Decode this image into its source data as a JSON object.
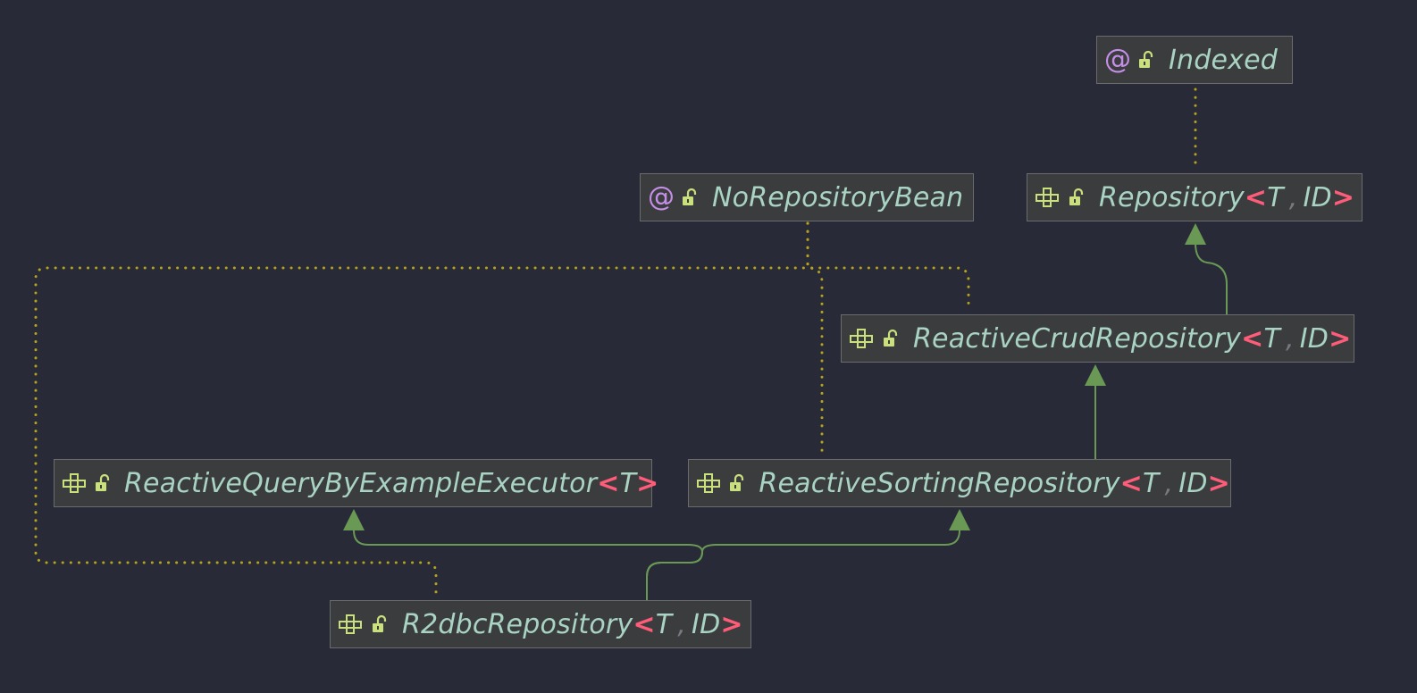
{
  "diagram": {
    "colors": {
      "background": "#282a37",
      "node_fill": "#3b3c3e",
      "node_border": "#6a6b6d",
      "name_text": "#a9d3c3",
      "generic_bracket": "#ff5c79",
      "annotation_icon": "#c58ee8",
      "interface_icon": "#c9e07c",
      "inheritance_edge": "#6a9955",
      "annotation_edge": "#b5a31a"
    },
    "nodes": [
      {
        "id": "indexed",
        "kind": "annotation",
        "icon": "at-icon",
        "name": "Indexed",
        "type_params": []
      },
      {
        "id": "no-repository-bean",
        "kind": "annotation",
        "icon": "at-icon",
        "name": "NoRepositoryBean",
        "type_params": []
      },
      {
        "id": "repository",
        "kind": "interface",
        "icon": "interface-icon",
        "name": "Repository",
        "type_params": [
          "T",
          "ID"
        ]
      },
      {
        "id": "reactive-crud-repository",
        "kind": "interface",
        "icon": "interface-icon",
        "name": "ReactiveCrudRepository",
        "type_params": [
          "T",
          "ID"
        ]
      },
      {
        "id": "reactive-query-by-example-executor",
        "kind": "interface",
        "icon": "interface-icon",
        "name": "ReactiveQueryByExampleExecutor",
        "type_params": [
          "T"
        ]
      },
      {
        "id": "reactive-sorting-repository",
        "kind": "interface",
        "icon": "interface-icon",
        "name": "ReactiveSortingRepository",
        "type_params": [
          "T",
          "ID"
        ]
      },
      {
        "id": "r2dbc-repository",
        "kind": "interface",
        "icon": "interface-icon",
        "name": "R2dbcRepository",
        "type_params": [
          "T",
          "ID"
        ]
      }
    ],
    "edges": [
      {
        "from": "repository",
        "to": "indexed",
        "type": "annotated-by"
      },
      {
        "from": "reactive-crud-repository",
        "to": "repository",
        "type": "extends"
      },
      {
        "from": "reactive-crud-repository",
        "to": "no-repository-bean",
        "type": "annotated-by"
      },
      {
        "from": "reactive-sorting-repository",
        "to": "reactive-crud-repository",
        "type": "extends"
      },
      {
        "from": "reactive-sorting-repository",
        "to": "no-repository-bean",
        "type": "annotated-by"
      },
      {
        "from": "r2dbc-repository",
        "to": "reactive-query-by-example-executor",
        "type": "extends"
      },
      {
        "from": "r2dbc-repository",
        "to": "reactive-sorting-repository",
        "type": "extends"
      },
      {
        "from": "r2dbc-repository",
        "to": "no-repository-bean",
        "type": "annotated-by"
      }
    ]
  }
}
